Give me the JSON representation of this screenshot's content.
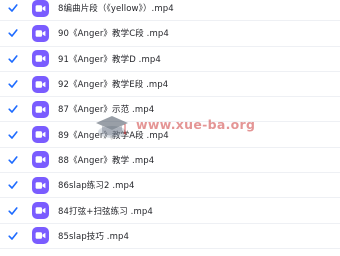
{
  "colors": {
    "checkbox_check": "#1e6bff",
    "file_icon_bg": "#7a5cff",
    "row_border": "#eef0f4",
    "filename_text": "#25262b",
    "watermark_red": "#c41414"
  },
  "icons": {
    "checkbox": "checkmark-icon",
    "file": "video-file-icon",
    "watermark_logo": "graduation-cap-logo"
  },
  "files": [
    {
      "name": "8编曲片段（《yellow》）.mp4",
      "checked": true
    },
    {
      "name": "90《Anger》教学C段 .mp4",
      "checked": true
    },
    {
      "name": "91《Anger》教学D .mp4",
      "checked": true
    },
    {
      "name": "92《Anger》教学E段 .mp4",
      "checked": true
    },
    {
      "name": "87《Anger》示范 .mp4",
      "checked": true
    },
    {
      "name": "89《Anger》教学A段 .mp4",
      "checked": true
    },
    {
      "name": "88《Anger》教学 .mp4",
      "checked": true
    },
    {
      "name": "86slap练习2 .mp4",
      "checked": true
    },
    {
      "name": "84打弦+扫弦练习 .mp4",
      "checked": true
    },
    {
      "name": "85slap技巧 .mp4",
      "checked": true
    }
  ],
  "watermark": {
    "text": "www.xue-ba.org"
  }
}
